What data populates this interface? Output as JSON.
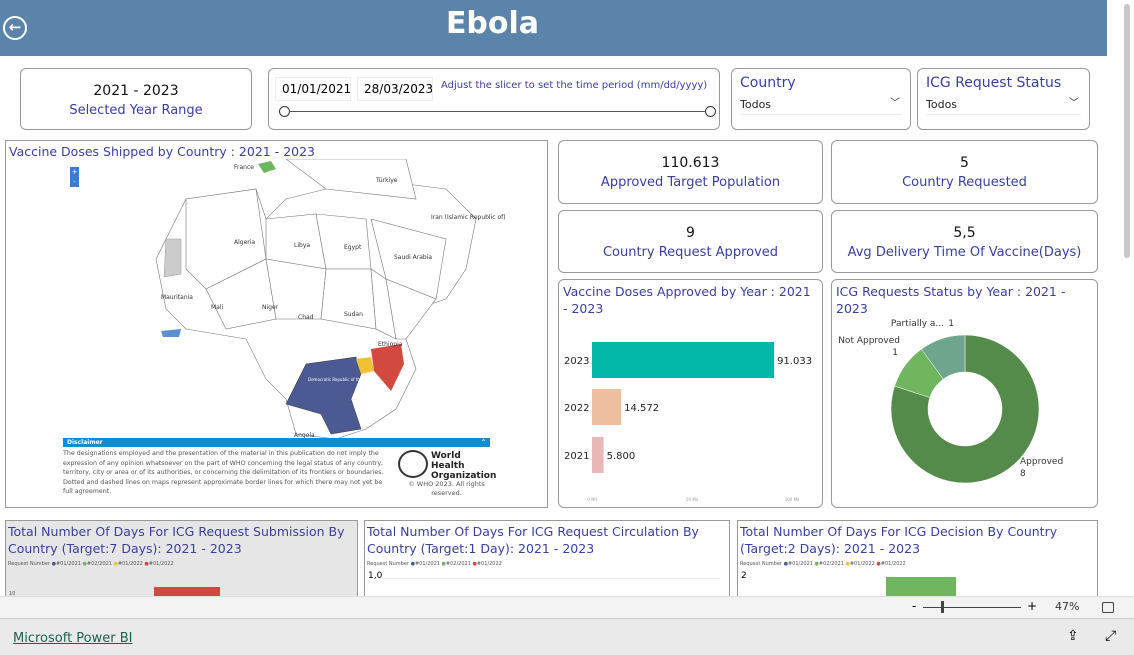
{
  "header": {
    "title": "Ebola",
    "back_icon": "arrow-left-circle-icon"
  },
  "year_range": {
    "value": "2021 - 2023",
    "label": "Selected Year Range"
  },
  "slicer": {
    "start": "01/01/2021",
    "end": "28/03/2023",
    "hint": "Adjust the slicer to set the time period (mm/dd/yyyy)"
  },
  "country_filter": {
    "label": "Country",
    "value": "Todos"
  },
  "icg_filter": {
    "label": "ICG Request Status",
    "value": "Todos"
  },
  "map": {
    "title": "Vaccine Doses Shipped by Country : 2021 - 2023",
    "labels": [
      "France",
      "Türkiye",
      "Iran (Islamic Republic of)",
      "Algeria",
      "Libya",
      "Egypt",
      "Saudi Arabia",
      "Mauritania",
      "Mali",
      "Niger",
      "Chad",
      "Sudan",
      "Ethiopia",
      "Democratic Republic of the Congo",
      "Angola"
    ],
    "disclaimer_title": "Disclaimer",
    "disclaimer": "The designations employed and the presentation of the material in this publication do not imply the expression of any opinion whatsoever on the part of WHO concerning the legal status of any country, territory, city or area or of its authorities, or concerning the delimitation of its frontiers or boundaries. Dotted and dashed lines on maps represent approximate border lines for which there may not yet be full agreement.",
    "who_logo": "World Health Organization",
    "copyright": "© WHO 2023. All rights reserved.",
    "colors": {
      "drc": "#4b5a92",
      "uganda": "#f0c232",
      "kenya": "#d24a3f",
      "guinea": "#5a8fd0",
      "switzerland": "#6fb65f"
    }
  },
  "kpis": [
    {
      "value": "110.613",
      "label": "Approved Target Population"
    },
    {
      "value": "5",
      "label": "Country Requested"
    },
    {
      "value": "9",
      "label": "Country Request Approved"
    },
    {
      "value": "5,5",
      "label": "Avg Delivery Time Of Vaccine(Days)"
    }
  ],
  "chart_data": [
    {
      "type": "bar",
      "title": "Vaccine Doses Approved by Year : 2021 - 2023",
      "categories": [
        "2023",
        "2022",
        "2021"
      ],
      "values": [
        91.033,
        14.572,
        5.8
      ],
      "labels": [
        "91.033",
        "14.572",
        "5.800"
      ],
      "colors": [
        "#02b8aa",
        "#eebf9f",
        "#e9b7b7"
      ],
      "xlim": [
        0,
        100
      ],
      "xticks": [
        "0 Mil",
        "50 Mil",
        "100 Mil"
      ]
    },
    {
      "type": "pie",
      "title": "ICG Requests Status by Year : 2021 - 2023",
      "categories": [
        "Approved",
        "Not Approved",
        "Partially a..."
      ],
      "values": [
        8,
        1,
        1
      ],
      "colors": [
        "#548a4a",
        "#6fb65f",
        "#6fa58c"
      ]
    },
    {
      "type": "bar",
      "title": "Total Number Of Days For ICG Request Submission By Country (Target:7 Days): 2021 - 2023",
      "legend_title": "Request Number",
      "legend": [
        "#01/2021",
        "#02/2021",
        "#01/2022",
        "#01/2022"
      ],
      "legend_colors": [
        "#4b5a92",
        "#6fb65f",
        "#f0c232",
        "#d24a3f"
      ],
      "yticks": [
        "10"
      ]
    },
    {
      "type": "bar",
      "title": "Total Number Of Days For ICG Request Circulation By Country (Target:1 Day): 2021 - 2023",
      "legend_title": "Request Number",
      "legend": [
        "#01/2021",
        "#02/2021",
        "#01/2022"
      ],
      "legend_colors": [
        "#4b5a92",
        "#6fb65f",
        "#d24a3f"
      ],
      "yticks": [
        "1,0"
      ]
    },
    {
      "type": "bar",
      "title": "Total Number Of Days For ICG Decision By Country (Target:2 Days): 2021 - 2023",
      "legend_title": "Request Number",
      "legend": [
        "#01/2021",
        "#02/2021",
        "#01/2022",
        "#01/2022"
      ],
      "legend_colors": [
        "#4b5a92",
        "#6fb65f",
        "#f0c232",
        "#d24a3f"
      ],
      "yticks": [
        "2"
      ]
    }
  ],
  "zoom": {
    "minus": "-",
    "plus": "+",
    "level": "47%",
    "percent": 47
  },
  "footer": {
    "brand": "Microsoft Power BI"
  }
}
